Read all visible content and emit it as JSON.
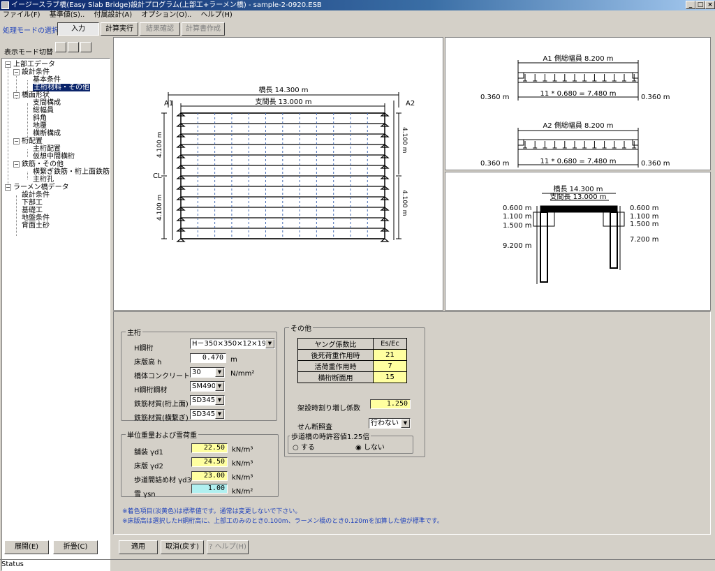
{
  "window": {
    "title": "イージースラブ橋(Easy Slab Bridge)設計プログラム(上部工+ラーメン橋) - sample-2-0920.ESB",
    "min": "_",
    "max": "□",
    "close": "×"
  },
  "menu": [
    "ファイル(F)",
    "基準値(S)..",
    "付属設計(A)",
    "オプション(O)..",
    "ヘルプ(H)"
  ],
  "mode": {
    "label": "処理モードの選択",
    "input": "入力",
    "calc": "計算実行",
    "result": "結果確認",
    "report": "計算書作成"
  },
  "left": {
    "display_switch": "表示モード切替",
    "expand": "展開(E)",
    "collapse": "折畳(C)"
  },
  "tree": [
    "上部工データ",
    "設計条件",
    "基本条件",
    "主桁材料・その他",
    "橋面形状",
    "支間構成",
    "総幅員",
    "斜角",
    "地覆",
    "横断構成",
    "桁配置",
    "主桁配置",
    "仮想中間横桁",
    "鉄筋・その他",
    "横繋ぎ鉄筋・桁上面鉄筋",
    "主桁孔",
    "ラーメン橋データ",
    "設計条件",
    "下部工",
    "基礎工",
    "地盤条件",
    "背面土砂"
  ],
  "plan": {
    "span_total": "橋長 14.300 m",
    "span_support": "支間長 13.000 m",
    "a1": "A1",
    "a2": "A2",
    "cl": "CL",
    "half_width": "4.100 m"
  },
  "section": {
    "a1_title": "A1  側総幅員  8.200 m",
    "a2_title": "A2  側総幅員  8.200 m",
    "overhang": "0.360 m",
    "girders": "11 * 0.680 = 7.480 m"
  },
  "frame": {
    "span_total": "橋長 14.300 m",
    "span_support": "支間長 13.000 m",
    "d1": "0.600 m",
    "d2": "1.100 m",
    "d3": "1.500 m",
    "h_left": "9.200 m",
    "h_right": "7.200 m"
  },
  "main_girder": {
    "title": "主桁",
    "steel_label": "H鋼桁",
    "steel_value": "H－350×350×12×19",
    "slab_label": "床版高 h",
    "slab_value": "0.470",
    "slab_unit": "m",
    "concrete_label": "橋体コンクリート",
    "concrete_value": "30",
    "concrete_unit": "N/mm²",
    "steel_mat_label": "H鋼桁鋼材",
    "steel_mat_value": "SM490Y",
    "rebar_top_label": "鉄筋材質(桁上面)",
    "rebar_top_value": "SD345",
    "rebar_tie_label": "鉄筋材質(横繋ぎ)",
    "rebar_tie_value": "SD345"
  },
  "unit_weight": {
    "title": "単位重量および雪荷重",
    "rows": [
      {
        "label": "舗装 γd1",
        "value": "22.50",
        "unit": "kN/m³"
      },
      {
        "label": "床版 γd2",
        "value": "24.50",
        "unit": "kN/m³"
      },
      {
        "label": "歩道間詰め材 γd3",
        "value": "23.00",
        "unit": "kN/m³"
      },
      {
        "label": "雪 γsn",
        "value": "1.00",
        "unit": "kN/m²"
      }
    ]
  },
  "other": {
    "title": "その他",
    "young_header": "ヤング係数比",
    "young_col": "Es/Ec",
    "young_rows": [
      {
        "label": "後死荷重作用時",
        "value": "21"
      },
      {
        "label": "活荷重作用時",
        "value": "7"
      },
      {
        "label": "横桁断面用",
        "value": "15"
      }
    ],
    "erect_label": "架設時割り増し係数",
    "erect_value": "1.250",
    "shear_label": "せん断照査",
    "shear_value": "行わない",
    "sidewalk_title": "歩道橋の時許容値1.25倍",
    "opt_yes": "する",
    "opt_no": "しない"
  },
  "notes": [
    "※着色項目(淡黄色)は標準値です。通常は変更しないで下さい。",
    "※床版高は選択したH鋼桁高に、上部工のみのとき0.100m、ラーメン橋のとき0.120mを加算した値が標準です。"
  ],
  "buttons": {
    "apply": "適用",
    "cancel": "取消(戻す)",
    "help": "ヘルプ(H)"
  },
  "status": "Status"
}
